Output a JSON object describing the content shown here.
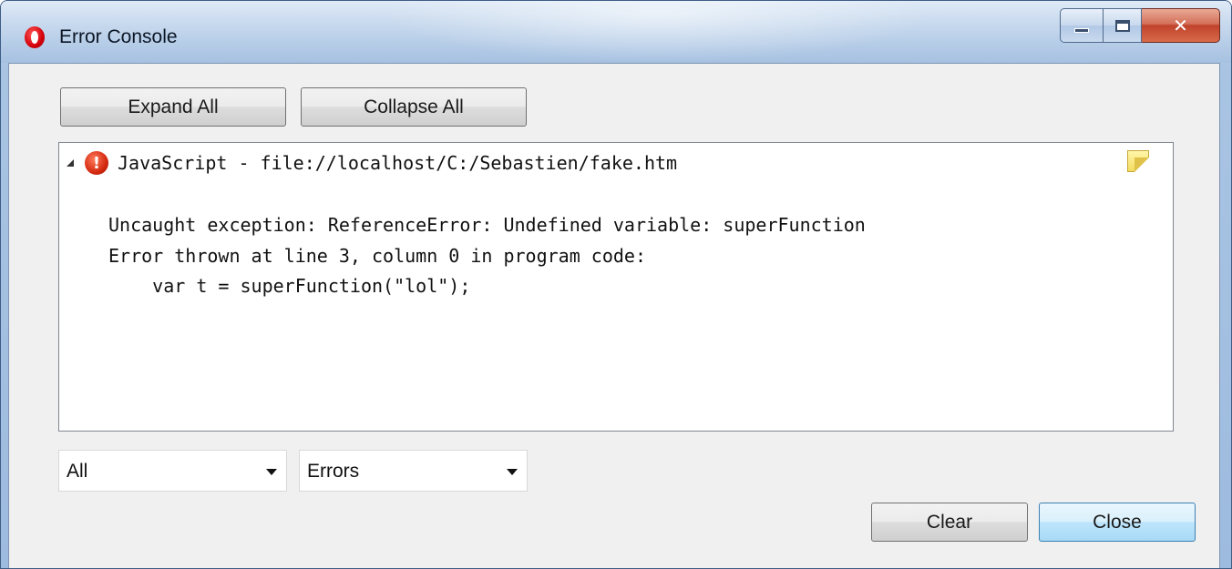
{
  "window": {
    "title": "Error Console"
  },
  "toolbar": {
    "expand_label": "Expand All",
    "collapse_label": "Collapse All"
  },
  "log": {
    "entries": [
      {
        "source": "JavaScript - file://localhost/C:/Sebastien/fake.htm",
        "message_lines": [
          "Uncaught exception: ReferenceError: Undefined variable: superFunction",
          "Error thrown at line 3, column 0 in program code:",
          "    var t = superFunction(\"lol\");"
        ]
      }
    ]
  },
  "filters": {
    "source_value": "All",
    "severity_value": "Errors"
  },
  "footer": {
    "clear_label": "Clear",
    "close_label": "Close"
  },
  "icons": {
    "app": "opera-logo-icon",
    "entry": "error-icon",
    "note": "note-icon"
  }
}
